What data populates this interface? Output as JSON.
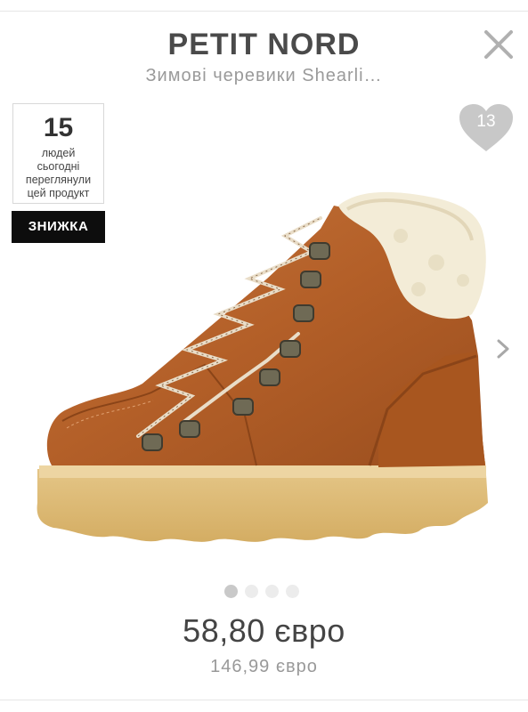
{
  "header": {
    "brand": "PETIT NORD",
    "product_title": "Зимові черевики Shearli…"
  },
  "views_widget": {
    "count": "15",
    "text": "людей\nсьогодні\nпереглянули\nцей продукт"
  },
  "sale_badge": "ЗНИЖКА",
  "favorites": {
    "count": "13"
  },
  "gallery": {
    "image_subject": "winter lace-up boot, cognac leather with shearling collar",
    "slide_count": 4,
    "active_slide": 1
  },
  "pricing": {
    "price": "58,80 євро",
    "old_price": "146,99 євро"
  },
  "icons": {
    "close": "close-icon",
    "favorite": "heart-icon",
    "next": "chevron-right-icon"
  },
  "colors": {
    "brand_text": "#4a4a4a",
    "heart": "#c8c8c8",
    "badge_bg": "#0d0d0d",
    "leather": "#b8652e"
  }
}
